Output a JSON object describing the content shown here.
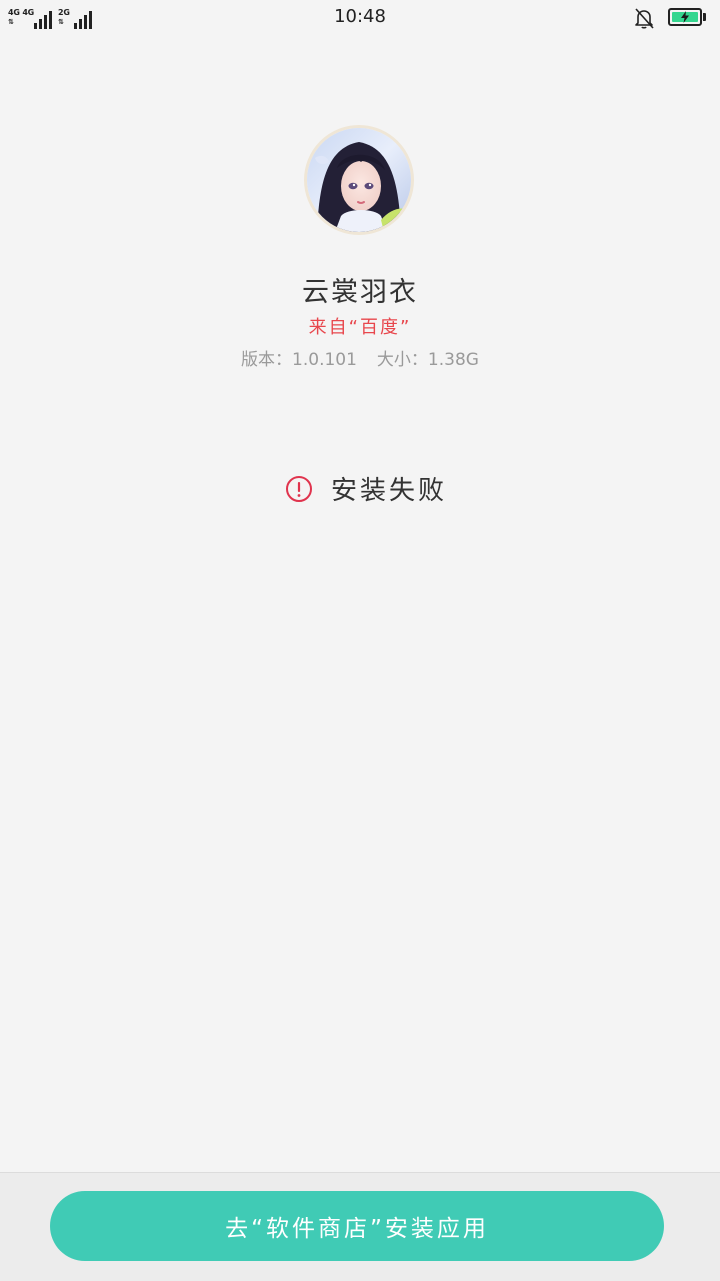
{
  "status_bar": {
    "time": "10:48",
    "sim1_network": "4G 4G",
    "sim2_network": "2G",
    "battery_color": "#35d68f"
  },
  "app": {
    "name": "云裳羽衣",
    "source": "来自“百度”",
    "version": "版本：1.0.101",
    "size": "大小：1.38G"
  },
  "status": {
    "message": "安装失败",
    "icon": "alert-circle-icon",
    "icon_color": "#e0334d"
  },
  "action": {
    "store_button_label": "去“软件商店”安装应用",
    "button_color": "#40cbb5"
  }
}
